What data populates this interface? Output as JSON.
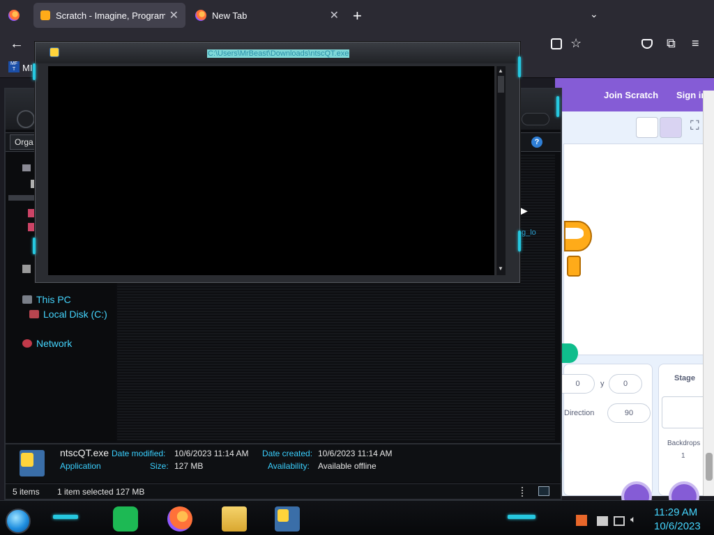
{
  "browser": {
    "tabs": [
      {
        "label": "Scratch - Imagine, Program, Sh",
        "active": true
      },
      {
        "label": "New Tab",
        "active": false
      }
    ],
    "new_tab_symbol": "+",
    "bookmark_label": "MI",
    "accent": "#2b2a33"
  },
  "scratch": {
    "join_label": "Join Scratch",
    "signin_label": "Sign in",
    "x_value": "0",
    "y_label": "y",
    "y_value": "0",
    "direction_label": "Direction",
    "direction_value": "90",
    "stage_label": "Stage",
    "backdrops_label": "Backdrops",
    "backdrops_count": "1",
    "brand_color": "#855cd6"
  },
  "explorer": {
    "toolbar_label": "Orga",
    "nav": {
      "this_pc": "This PC",
      "local_disk": "Local Disk (C:)",
      "network": "Network"
    },
    "partial_text": "g_lo",
    "details": {
      "file_name": "ntscQT.exe",
      "file_type": "Application",
      "date_modified_label": "Date modified:",
      "date_modified_value": "10/6/2023 11:14 AM",
      "size_label": "Size:",
      "size_value": "127 MB",
      "date_created_label": "Date created:",
      "date_created_value": "10/6/2023 11:14 AM",
      "availability_label": "Availability:",
      "availability_value": "Available offline"
    },
    "status": {
      "items": "5 items",
      "selected": "1 item selected  127 MB"
    },
    "accent": "#26c8e0"
  },
  "console": {
    "title": "C:\\Users\\MrBeast\\Downloads\\ntscQT.exe"
  },
  "taskbar": {
    "time": "11:29 AM",
    "date": "10/6/2023",
    "apps": [
      "notes-app-icon",
      "firefox-icon",
      "file-explorer-icon",
      "ntscqt-icon"
    ]
  }
}
